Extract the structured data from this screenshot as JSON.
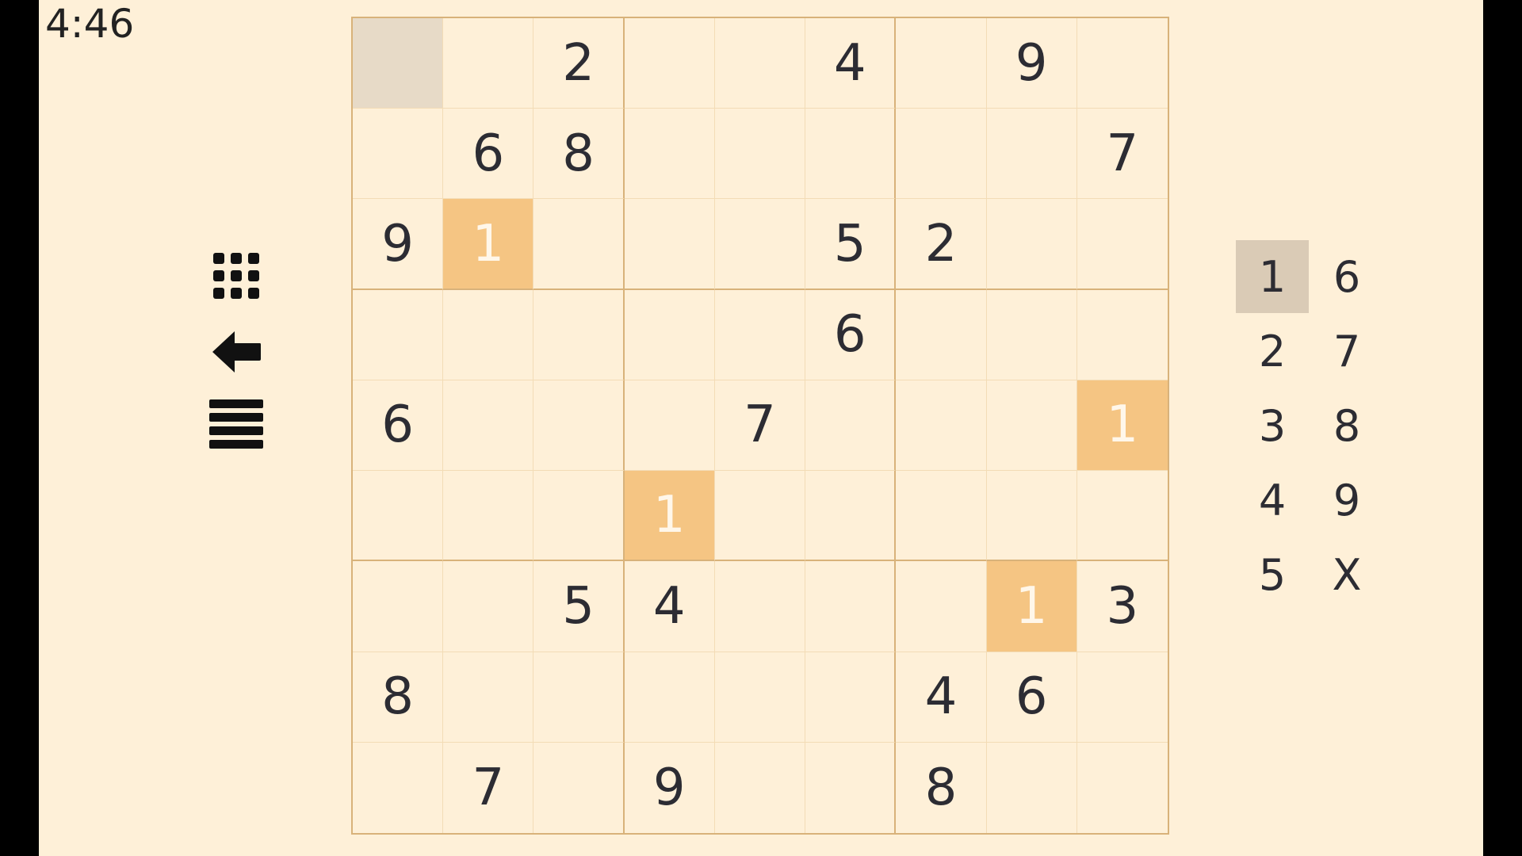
{
  "timer": "4:46",
  "toolbar": {
    "grid_icon": "grid-icon",
    "undo_icon": "arrow-left-icon",
    "menu_icon": "hamburger-menu-icon"
  },
  "board": {
    "selected_cell": [
      0,
      0
    ],
    "highlighted_digit": "1",
    "rows": [
      [
        "",
        "",
        "2",
        "",
        "",
        "4",
        "",
        "9",
        ""
      ],
      [
        "",
        "6",
        "8",
        "",
        "",
        "",
        "",
        "",
        "7"
      ],
      [
        "9",
        "1",
        "",
        "",
        "",
        "5",
        "2",
        "",
        ""
      ],
      [
        "",
        "",
        "",
        "",
        "",
        "6",
        "",
        "",
        ""
      ],
      [
        "6",
        "",
        "",
        "",
        "7",
        "",
        "",
        "",
        "1"
      ],
      [
        "",
        "",
        "",
        "1",
        "",
        "",
        "",
        "",
        ""
      ],
      [
        "",
        "",
        "5",
        "4",
        "",
        "",
        "",
        "1",
        "3"
      ],
      [
        "8",
        "",
        "",
        "",
        "",
        "",
        "4",
        "6",
        ""
      ],
      [
        "",
        "7",
        "",
        "9",
        "",
        "",
        "8",
        "",
        ""
      ]
    ]
  },
  "numpad": {
    "active": "1",
    "keys": [
      [
        "1",
        "6"
      ],
      [
        "2",
        "7"
      ],
      [
        "3",
        "8"
      ],
      [
        "4",
        "9"
      ],
      [
        "5",
        "X"
      ]
    ]
  },
  "colors": {
    "background": "#fef0d8",
    "highlight": "#f5c583",
    "selected": "#e7dac7",
    "grid_line": "#d8b27a"
  }
}
